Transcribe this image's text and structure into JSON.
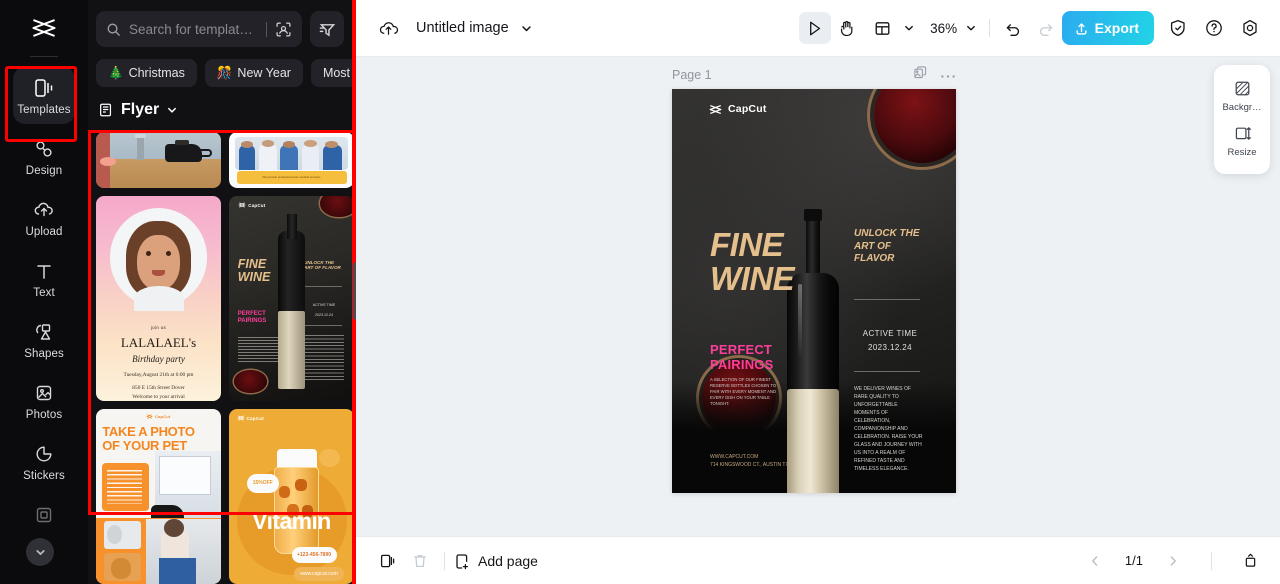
{
  "rail": {
    "logo_icon": "capcut-logo",
    "items": [
      {
        "label": "Templates",
        "icon": "templates-icon",
        "active": true
      },
      {
        "label": "Design",
        "icon": "design-icon",
        "active": false
      },
      {
        "label": "Upload",
        "icon": "upload-cloud-icon",
        "active": false
      },
      {
        "label": "Text",
        "icon": "text-icon",
        "active": false
      },
      {
        "label": "Shapes",
        "icon": "shapes-icon",
        "active": false
      },
      {
        "label": "Photos",
        "icon": "photos-icon",
        "active": false
      },
      {
        "label": "Stickers",
        "icon": "stickers-icon",
        "active": false
      },
      {
        "label": "",
        "icon": "frames-icon",
        "active": false
      }
    ],
    "scroll_icon": "chevron-down-icon"
  },
  "panel": {
    "search": {
      "placeholder": "Search for templat…",
      "search_icon": "search-icon",
      "visual_search_icon": "image-search-icon"
    },
    "filter_icon": "filter-icon",
    "chips": [
      {
        "label": "Christmas",
        "emoji": "🎄"
      },
      {
        "label": "New Year",
        "emoji": "🎊"
      },
      {
        "label": "Most",
        "emoji": ""
      }
    ],
    "category": {
      "label": "Flyer",
      "icon": "category-icon",
      "chevron": "chevron-down-icon"
    },
    "templates": [
      {
        "name": "coffee-kettle-flyer",
        "kind": "coffee"
      },
      {
        "name": "medical-team-flyer",
        "kind": "medical",
        "caption": "We provide professional pet medical services"
      },
      {
        "name": "birthday-party-flyer",
        "kind": "birthday",
        "join": "join us",
        "title": "LALALAEL's",
        "script": "Birthday party",
        "line1": "Tuesday,August 21th at 6:00 pm",
        "line2": "850 E  15th Street Dover",
        "line3": "Welcome to your arrival"
      },
      {
        "name": "fine-wine-flyer",
        "kind": "wine",
        "brand": "CapCut",
        "headline": "FINE WINE",
        "sub": "UNLOCK THE ART OF FLAVOR",
        "pink": "PERFECT PAIRINGS",
        "active_time": "ACTIVE TIME",
        "date": "2023.12.24"
      },
      {
        "name": "pet-photo-flyer",
        "kind": "pet",
        "brand": "CapCut",
        "headline": "TAKE A PHOTO OF YOUR PET"
      },
      {
        "name": "vitamin-flyer",
        "kind": "vitamin",
        "brand": "CapCut",
        "headline": "Vitamin",
        "badge": "15%OFF",
        "phone": "+123-456-7890",
        "site": "www.capcut.com"
      }
    ],
    "resize_handle": "panel-resize-handle"
  },
  "topbar": {
    "cloud_icon": "cloud-upload-icon",
    "title": "Untitled image",
    "title_chevron": "chevron-down-icon",
    "tools": [
      {
        "name": "select-tool",
        "icon": "cursor-icon",
        "selected": true
      },
      {
        "name": "hand-tool",
        "icon": "hand-icon",
        "selected": false
      },
      {
        "name": "layout-tool",
        "icon": "layout-icon",
        "selected": false
      }
    ],
    "layout_chevron": "chevron-down-icon",
    "zoom": "36%",
    "zoom_chevron": "chevron-down-icon",
    "undo_icon": "undo-icon",
    "redo_icon": "redo-icon",
    "export_label": "Export",
    "export_icon": "upload-icon",
    "shield_icon": "shield-check-icon",
    "help_icon": "help-circle-icon",
    "settings_icon": "gear-icon",
    "accent": "#22d3e6"
  },
  "canvas": {
    "page_label": "Page 1",
    "duplicate_icon": "duplicate-page-icon",
    "more_icon": "more-options-icon",
    "poster": {
      "brand": "CapCut",
      "headline_line1": "FINE",
      "headline_line2": "WINE",
      "subhead": "UNLOCK THE ART OF FLAVOR",
      "pink_line1": "PERFECT",
      "pink_line2": "PAIRINGS",
      "body_left": "A SELECTION OF OUR FINEST RESERVE BOTTLES CHOSEN TO PAIR WITH EVERY MOMENT AND EVERY DISH ON YOUR TABLE TONIGHT.",
      "active_time_label": "ACTIVE TIME",
      "active_time_value": "2023.12.24",
      "body_right": "WE DELIVER WINES OF RARE QUALITY TO UNFORGETTABLE MOMENTS OF CELEBRATION, COMPANIONSHIP AND CELEBRATION. RAISE YOUR GLASS AND JOURNEY WITH US INTO A REALM OF REFINED TASTE AND TIMELESS ELEGANCE.",
      "footer_line1": "WWW.CAPCUT.COM",
      "footer_line2": "714 KINGSWOOD CT., AUSTIN TX"
    }
  },
  "right_panel": {
    "items": [
      {
        "label": "Backgr…",
        "icon": "background-icon"
      },
      {
        "label": "Resize",
        "icon": "resize-icon"
      }
    ]
  },
  "bottombar": {
    "duplicate_icon": "duplicate-icon",
    "delete_icon": "trash-icon",
    "add_page_label": "Add page",
    "add_page_icon": "add-page-icon",
    "prev_icon": "chevron-left-icon",
    "page_indicator": "1/1",
    "next_icon": "chevron-right-icon",
    "collapse_icon": "collapse-panel-icon"
  },
  "highlights": {
    "color": "#ff0000",
    "regions": [
      "templates-rail-item",
      "template-grid"
    ]
  }
}
